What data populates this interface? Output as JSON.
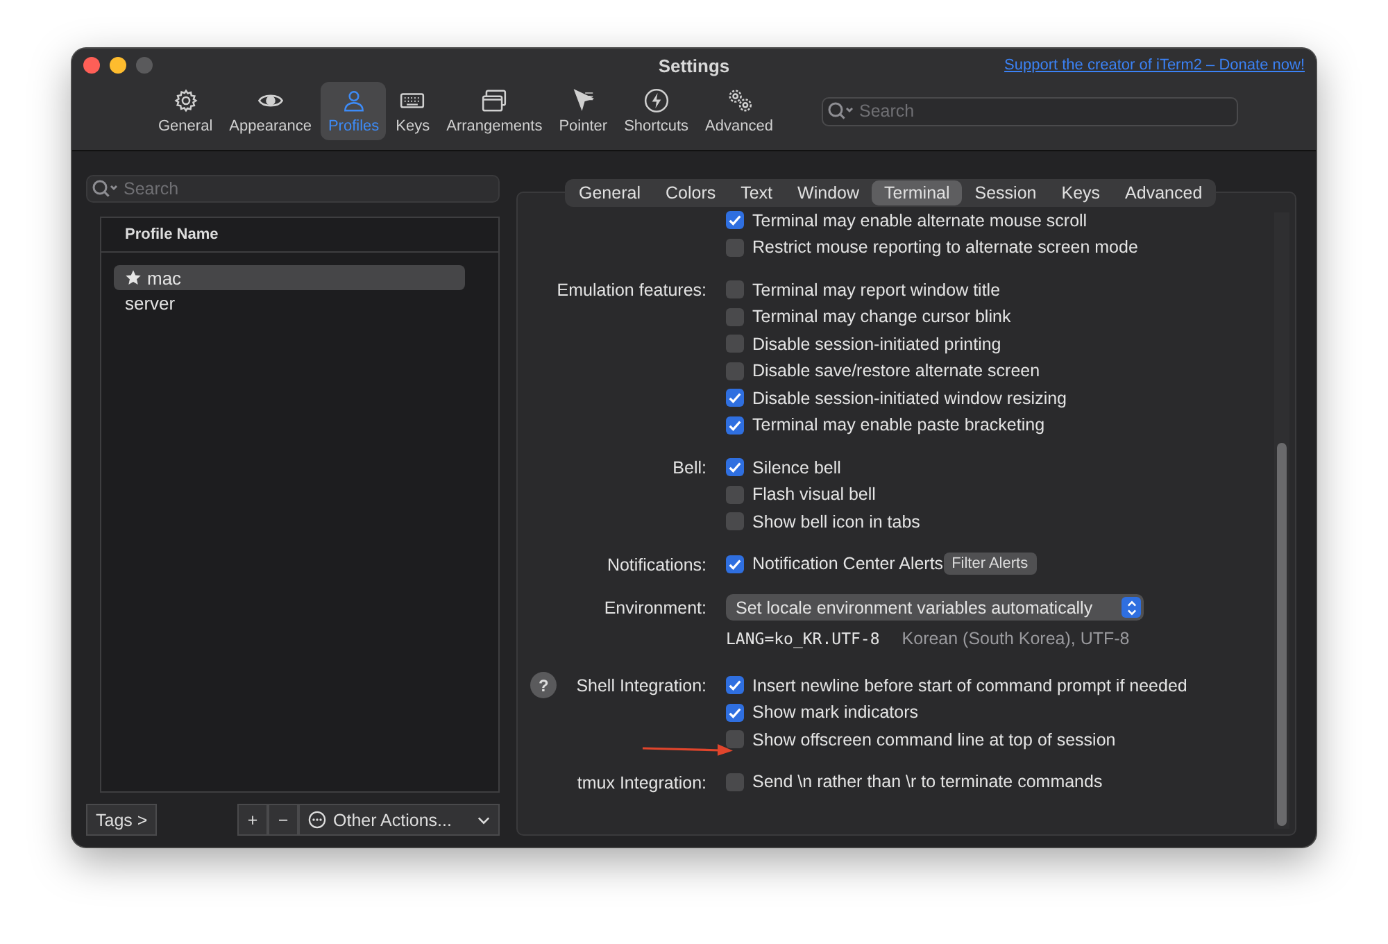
{
  "window": {
    "title": "Settings",
    "donate_link": "Support the creator of iTerm2 – Donate now!"
  },
  "toolbar": [
    {
      "label": "General",
      "kind": "gear",
      "selected": false
    },
    {
      "label": "Appearance",
      "kind": "eye",
      "selected": false
    },
    {
      "label": "Profiles",
      "kind": "person",
      "selected": true
    },
    {
      "label": "Keys",
      "kind": "keyboard",
      "selected": false
    },
    {
      "label": "Arrangements",
      "kind": "windows",
      "selected": false
    },
    {
      "label": "Pointer",
      "kind": "pointer",
      "selected": false
    },
    {
      "label": "Shortcuts",
      "kind": "bolt",
      "selected": false
    },
    {
      "label": "Advanced",
      "kind": "gears",
      "selected": false
    }
  ],
  "toolbar_search": {
    "placeholder": "Search"
  },
  "profiles": {
    "search": {
      "placeholder": "Search"
    },
    "column": "Profile Name",
    "rows": [
      {
        "name": "mac",
        "default": true,
        "selected": true
      },
      {
        "name": "server",
        "default": false,
        "selected": false
      }
    ],
    "tags_button": "Tags >",
    "add_button": "+",
    "remove_button": "−",
    "actions_menu": "Other Actions..."
  },
  "tabs": [
    {
      "label": "General",
      "selected": false
    },
    {
      "label": "Colors",
      "selected": false
    },
    {
      "label": "Text",
      "selected": false
    },
    {
      "label": "Window",
      "selected": false
    },
    {
      "label": "Terminal",
      "selected": true
    },
    {
      "label": "Session",
      "selected": false
    },
    {
      "label": "Keys",
      "selected": false
    },
    {
      "label": "Advanced",
      "selected": false
    }
  ],
  "sections": [
    {
      "rows": [
        {
          "kind": "checkbox",
          "text": "Terminal may enable alternate mouse scroll",
          "checked": true
        },
        {
          "kind": "checkbox",
          "text": "Restrict mouse reporting to alternate screen mode",
          "checked": false
        }
      ]
    },
    {
      "label": "Emulation features:",
      "rows": [
        {
          "kind": "checkbox",
          "text": "Terminal may report window title",
          "checked": false
        },
        {
          "kind": "checkbox",
          "text": "Terminal may change cursor blink",
          "checked": false
        },
        {
          "kind": "checkbox",
          "text": "Disable session-initiated printing",
          "checked": false
        },
        {
          "kind": "checkbox",
          "text": "Disable save/restore alternate screen",
          "checked": false
        },
        {
          "kind": "checkbox",
          "text": "Disable session-initiated window resizing",
          "checked": true
        },
        {
          "kind": "checkbox",
          "text": "Terminal may enable paste bracketing",
          "checked": true
        }
      ]
    },
    {
      "label": "Bell:",
      "rows": [
        {
          "kind": "checkbox",
          "text": "Silence bell",
          "checked": true
        },
        {
          "kind": "checkbox",
          "text": "Flash visual bell",
          "checked": false
        },
        {
          "kind": "checkbox",
          "text": "Show bell icon in tabs",
          "checked": false
        }
      ]
    },
    {
      "label": "Notifications:",
      "rows": [
        {
          "kind": "checkbox",
          "text": "Notification Center Alerts",
          "checked": true,
          "button": "Filter Alerts"
        }
      ]
    },
    {
      "label": "Environment:",
      "rows": [
        {
          "kind": "select",
          "text": "Set locale environment variables automatically"
        },
        {
          "kind": "info",
          "text": "LANG=ko_KR.UTF-8",
          "note": "Korean (South Korea), UTF-8"
        }
      ]
    },
    {
      "label": "Shell Integration:",
      "help": "?",
      "rows": [
        {
          "kind": "checkbox",
          "text": "Insert newline before start of command prompt if needed",
          "checked": true
        },
        {
          "kind": "checkbox",
          "text": "Show mark indicators",
          "checked": true
        },
        {
          "kind": "checkbox",
          "text": "Show offscreen command line at top of session",
          "checked": false
        }
      ]
    },
    {
      "label": "tmux Integration:",
      "rows": [
        {
          "kind": "checkbox",
          "text": "Send \\n rather than \\r to terminate commands",
          "checked": false
        }
      ]
    }
  ]
}
